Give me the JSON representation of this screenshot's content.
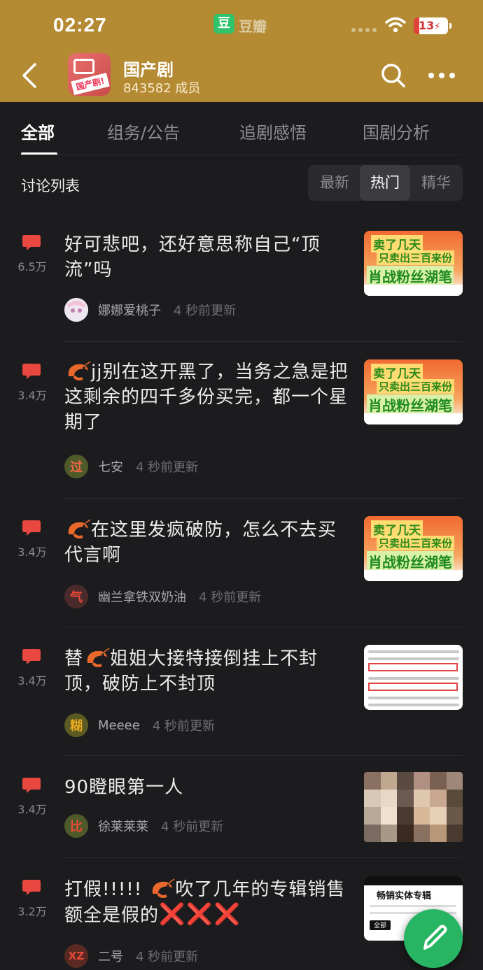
{
  "status_bar": {
    "time": "02:27",
    "app_glyph": "豆",
    "app_name": "豆瓣",
    "battery": "13"
  },
  "header": {
    "title": "国产剧",
    "members": "843582 成员",
    "avatar_label": "国产剧!",
    "accent_color": "#b48a33"
  },
  "tabs": [
    {
      "label": "全部",
      "active": true
    },
    {
      "label": "组务/公告",
      "active": false
    },
    {
      "label": "追剧感悟",
      "active": false
    },
    {
      "label": "国剧分析",
      "active": false
    }
  ],
  "list": {
    "label": "讨论列表",
    "sort_options": [
      {
        "label": "最新",
        "active": false
      },
      {
        "label": "热门",
        "active": true
      },
      {
        "label": "精华",
        "active": false
      }
    ]
  },
  "posts": [
    {
      "reply_count": "6.5万",
      "title": "好可悲吧，还好意思称自己“顶流”吗",
      "author": "娜娜爱桃子",
      "updated": "4 秒前更新",
      "thumb": "promo"
    },
    {
      "reply_count": "3.4万",
      "title_pre": "",
      "title_post": "jj别在这开黑了，当务之急是把这剩余的四千多份买完，都一个星期了",
      "author": "七安",
      "avatar_char": "过",
      "updated": "4 秒前更新",
      "thumb": "promo"
    },
    {
      "reply_count": "3.4万",
      "title_post": "在这里发疯破防，怎么不去买代言啊",
      "author": "幽兰拿铁双奶油",
      "avatar_char": "气",
      "updated": "4 秒前更新",
      "thumb": "promo"
    },
    {
      "reply_count": "3.4万",
      "title_pre": "替",
      "title_post": "姐姐大接特接倒挂上不封顶，破防上不封顶",
      "author": "Meeee",
      "avatar_char": "糊",
      "updated": "4 秒前更新",
      "thumb": "table"
    },
    {
      "reply_count": "3.4万",
      "title": "90瞪眼第一人",
      "author": "徐莱莱莱",
      "avatar_char": "比",
      "updated": "4 秒前更新",
      "thumb": "mosaic"
    },
    {
      "reply_count": "3.2万",
      "title_pre": "打假!!!!! ",
      "title_post": "吹了几年的专辑销售额全是假的",
      "title_marks": "❌❌❌",
      "author": "二号",
      "avatar_char": "XZ",
      "updated": "4 秒前更新",
      "thumb": "chart"
    }
  ],
  "promo_thumb": {
    "line1": "卖了几天",
    "line2": "只卖出三百来份",
    "line3": "肖战粉丝湖笔"
  },
  "chart_thumb": {
    "title": "畅销实体专辑",
    "chip": "全部"
  },
  "icons": {
    "back": "chevron-left-icon",
    "search": "search-icon",
    "more": "more-dots-icon",
    "reply": "comment-bubble-icon",
    "compose": "pencil-icon"
  }
}
